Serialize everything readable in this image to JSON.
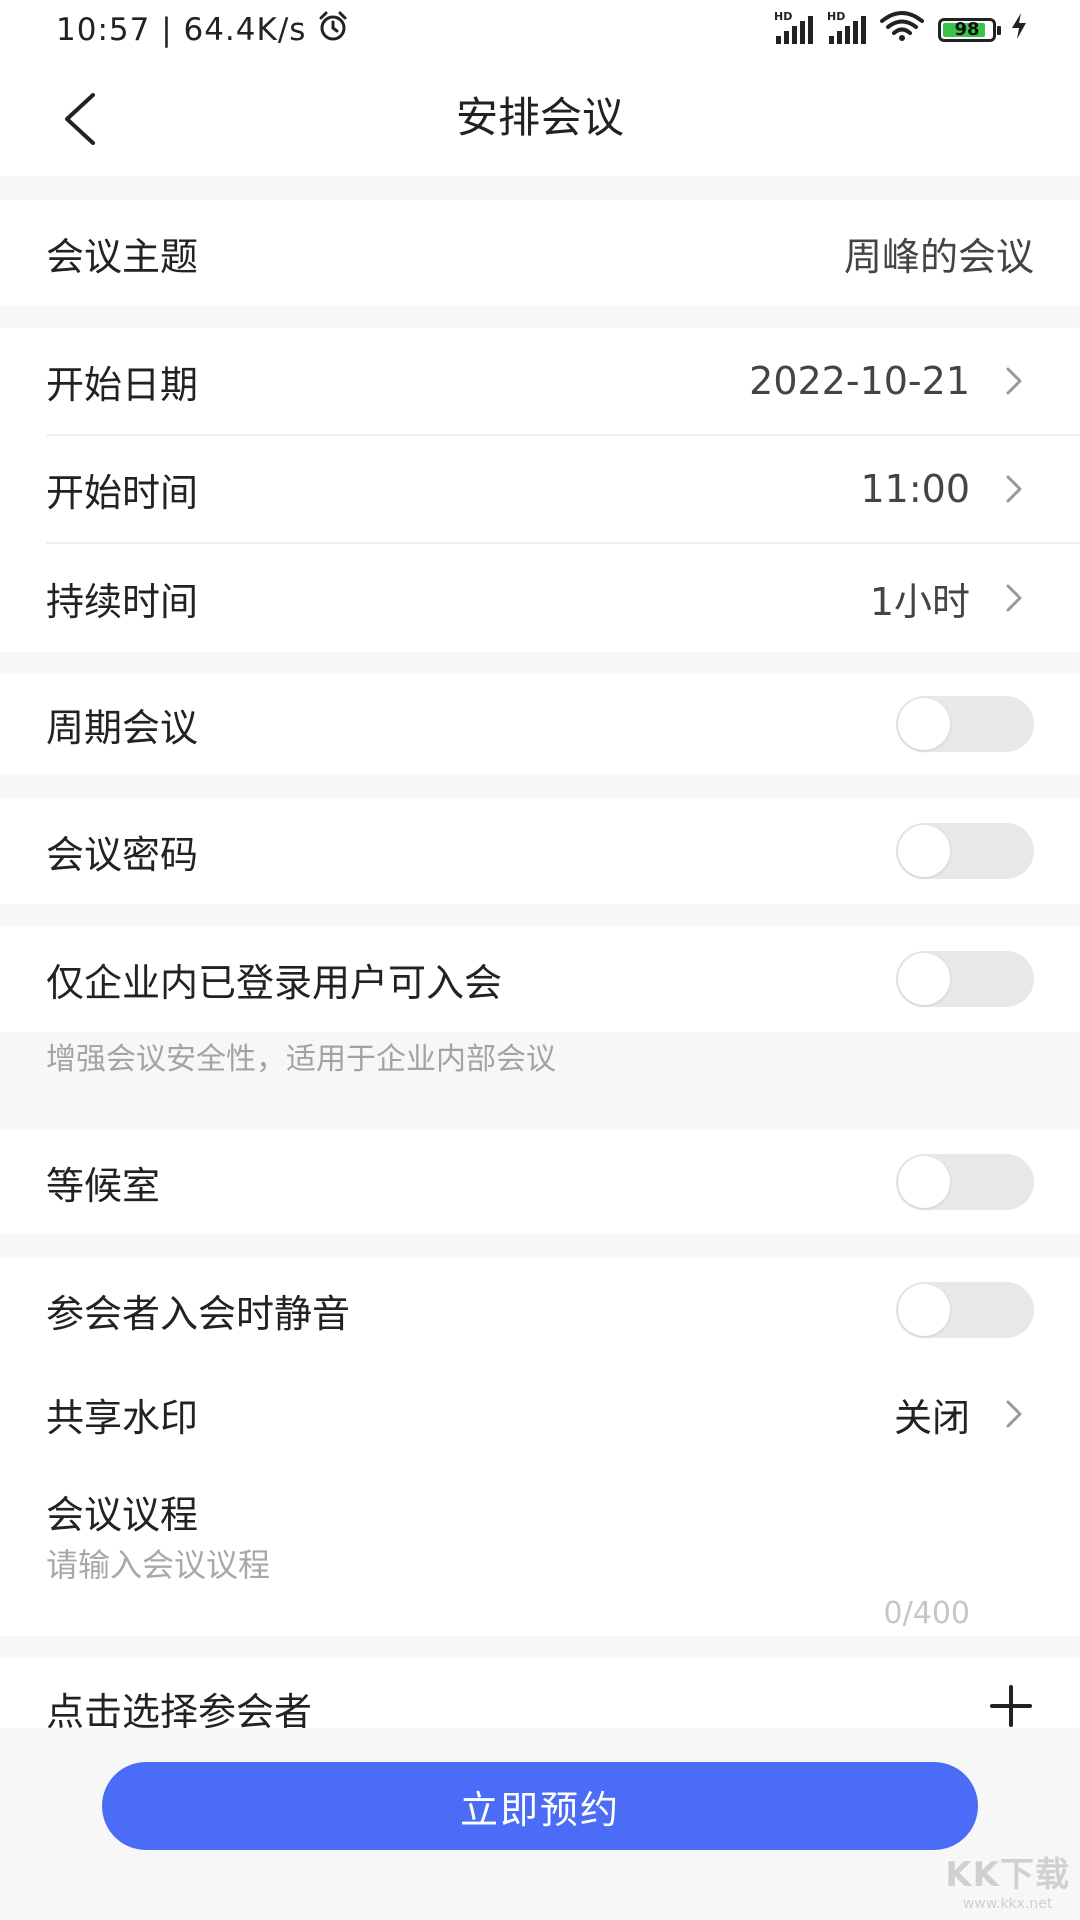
{
  "status_bar": {
    "time_speed": "10:57 | 64.4K/s",
    "hd_label": "HD",
    "battery_level": "98"
  },
  "nav": {
    "title": "安排会议"
  },
  "form": {
    "topic": {
      "label": "会议主题",
      "value": "周峰的会议"
    },
    "start_date": {
      "label": "开始日期",
      "value": "2022-10-21"
    },
    "start_time": {
      "label": "开始时间",
      "value": "11:00"
    },
    "duration": {
      "label": "持续时间",
      "value": "1小时"
    },
    "recurring": {
      "label": "周期会议",
      "enabled": false
    },
    "password": {
      "label": "会议密码",
      "enabled": false
    },
    "enterprise_only": {
      "label": "仅企业内已登录用户可入会",
      "hint": "增强会议安全性，适用于企业内部会议",
      "enabled": false
    },
    "waiting_room": {
      "label": "等候室",
      "enabled": false
    },
    "mute_on_entry": {
      "label": "参会者入会时静音",
      "enabled": false
    },
    "watermark": {
      "label": "共享水印",
      "value": "关闭"
    },
    "agenda": {
      "label": "会议议程",
      "placeholder": "请输入会议议程",
      "value": "",
      "counter": "0/400"
    },
    "participants": {
      "label": "点击选择参会者"
    }
  },
  "actions": {
    "submit_label": "立即预约"
  },
  "watermark_logo": {
    "main": "KK下载",
    "sub": "www.kkx.net"
  },
  "colors": {
    "accent": "#4a6cf7",
    "toggle_off": "#e8e8ea",
    "page_bg": "#f7f7f7",
    "hint_text": "#a3a3a3"
  }
}
